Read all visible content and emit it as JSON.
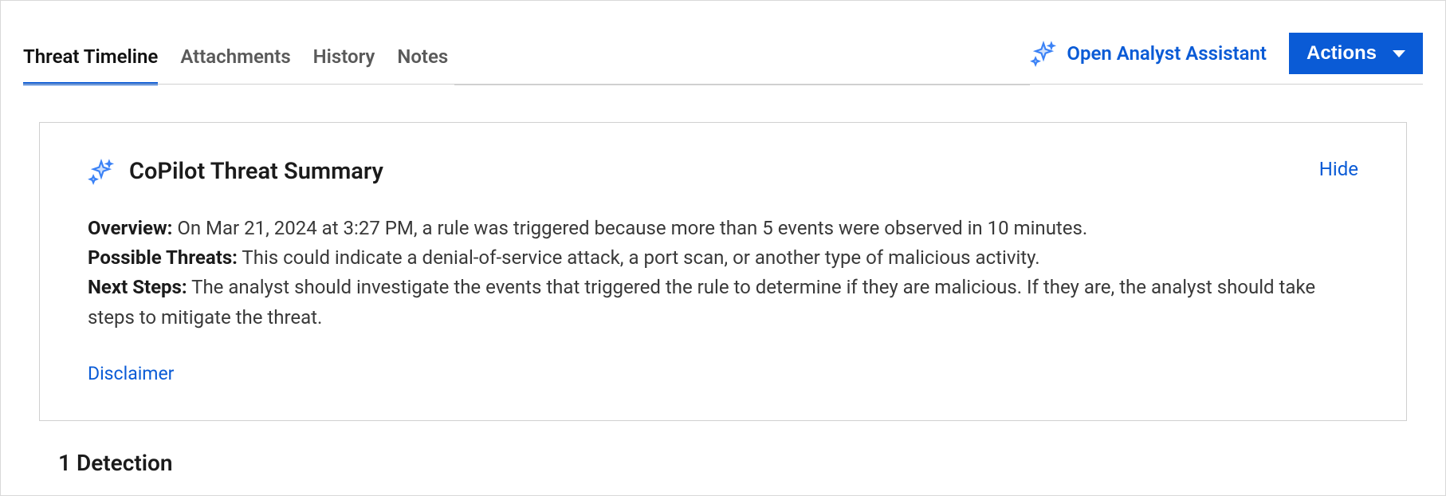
{
  "tabs": {
    "threat_timeline": "Threat Timeline",
    "attachments": "Attachments",
    "history": "History",
    "notes": "Notes"
  },
  "header": {
    "assistant_label": "Open Analyst Assistant",
    "actions_label": "Actions"
  },
  "card": {
    "title": "CoPilot Threat Summary",
    "hide_label": "Hide",
    "overview_label": "Overview:",
    "overview_text": "On Mar 21, 2024 at 3:27 PM, a rule was triggered because more than 5 events were observed in 10 minutes.",
    "threats_label": "Possible Threats:",
    "threats_text": "This could indicate a denial-of-service attack, a port scan, or another type of malicious activity.",
    "next_label": "Next Steps:",
    "next_text": "The analyst should investigate the events that triggered the rule to determine if they are malicious. If they are, the analyst should take steps to mitigate the threat.",
    "disclaimer_label": "Disclaimer"
  },
  "detections": {
    "heading": "1 Detection"
  }
}
